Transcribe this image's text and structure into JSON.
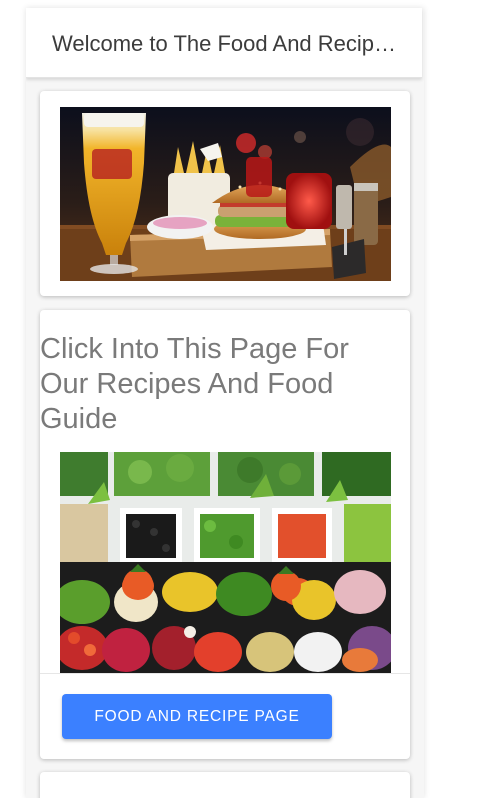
{
  "header": {
    "title": "Welcome to The Food And Recipe Guide"
  },
  "hero_card": {
    "image": "burger-and-beer-photo"
  },
  "recipe_card": {
    "heading": "Click Into This Page For Our Recipes And Food Guide",
    "image": "vegetable-salad-bar-photo",
    "button_label": "FOOD AND RECIPE PAGE"
  },
  "colors": {
    "accent": "#3b80ff",
    "toolbar_bg": "#ffffff",
    "page_bg": "#f6f6f6",
    "heading_text": "#7a7a7a"
  }
}
